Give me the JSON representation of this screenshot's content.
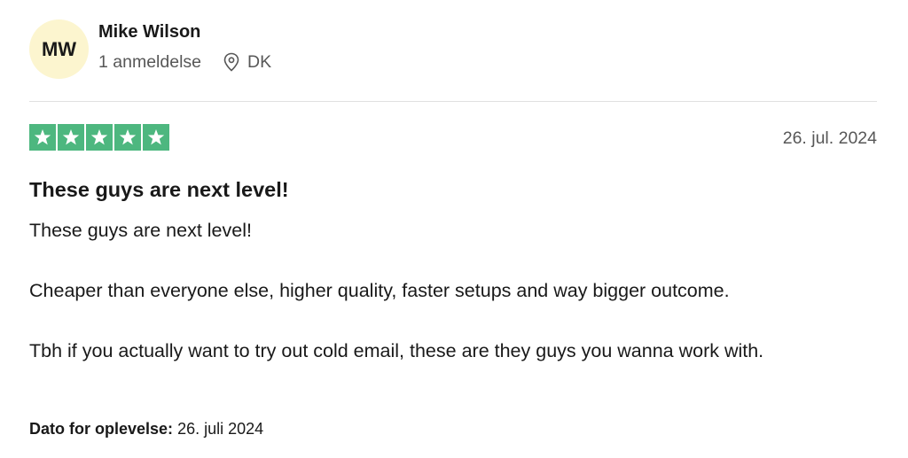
{
  "reviewer": {
    "initials": "MW",
    "name": "Mike Wilson",
    "review_count": "1 anmeldelse",
    "country": "DK"
  },
  "review": {
    "rating": 5,
    "max_rating": 5,
    "date": "26. jul. 2024",
    "title": "These guys are next level!",
    "paragraphs": [
      "These guys are next level!",
      "Cheaper than everyone else, higher quality, faster setups and way bigger outcome.",
      "Tbh if you actually want to try out cold email, these are they guys you wanna work with."
    ],
    "experience_label": "Dato for oplevelse:",
    "experience_date": "26. juli 2024"
  },
  "colors": {
    "star_background": "#4db77f",
    "avatar_background": "#fcf5cf"
  },
  "icons": {
    "location": "location-pin-icon",
    "star": "star-icon"
  }
}
